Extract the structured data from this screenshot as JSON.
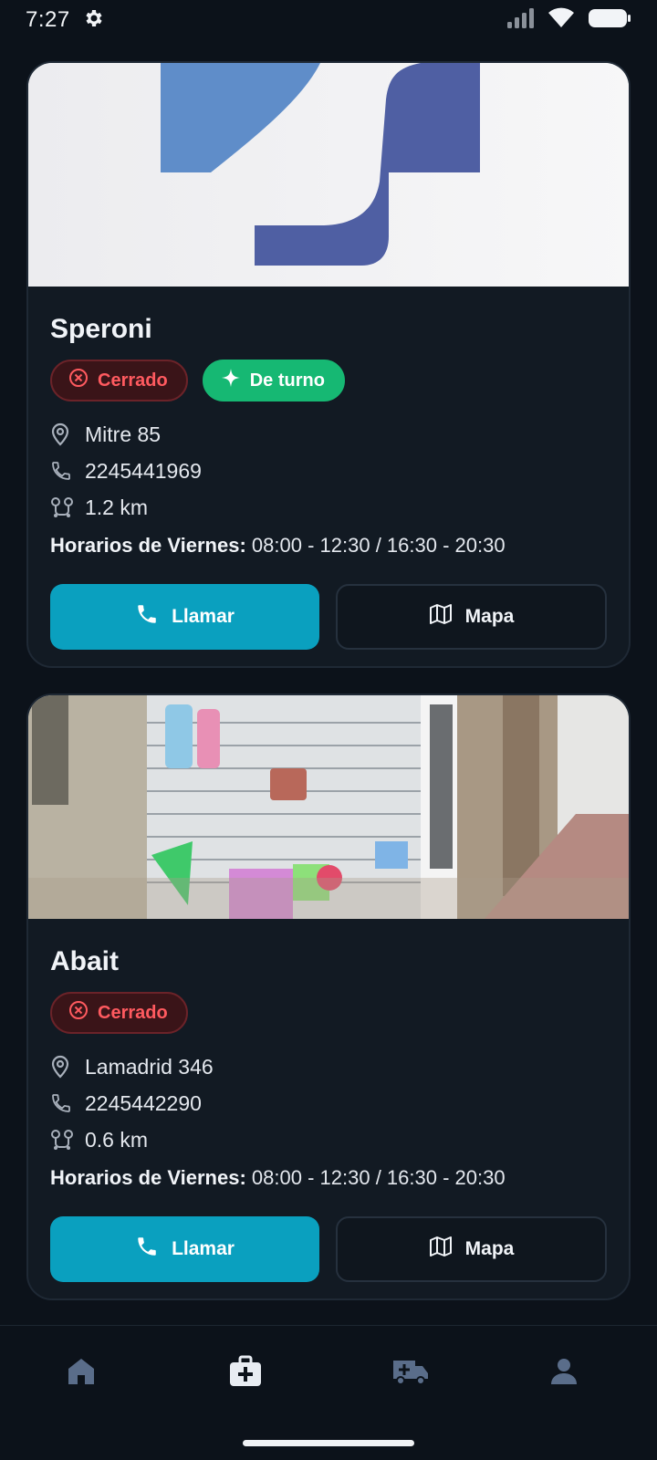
{
  "status_bar": {
    "time": "7:27",
    "icons": [
      "settings-icon",
      "signal-icon",
      "wifi-icon",
      "battery-icon"
    ]
  },
  "pharmacies": [
    {
      "name": "Speroni",
      "status_label": "Cerrado",
      "on_duty_label": "De turno",
      "address": "Mitre 85",
      "phone": "2245441969",
      "distance": "1.2 km",
      "hours_label": "Horarios de Viernes:",
      "hours_value": "08:00 - 12:30 / 16:30 - 20:30",
      "call_label": "Llamar",
      "map_label": "Mapa"
    },
    {
      "name": "Abait",
      "status_label": "Cerrado",
      "address": "Lamadrid 346",
      "phone": "2245442290",
      "distance": "0.6 km",
      "hours_label": "Horarios de Viernes:",
      "hours_value": "08:00 - 12:30 / 16:30 - 20:30",
      "call_label": "Llamar",
      "map_label": "Mapa"
    }
  ],
  "bottom_nav": {
    "items": [
      "home-icon",
      "medical-kit-icon",
      "ambulance-icon",
      "profile-icon"
    ],
    "active": "medical-kit-icon"
  },
  "colors": {
    "background": "#0c121a",
    "card": "#121a23",
    "accent": "#0aa0bf",
    "closed": "#ff5a5f",
    "on_duty": "#16b873"
  }
}
